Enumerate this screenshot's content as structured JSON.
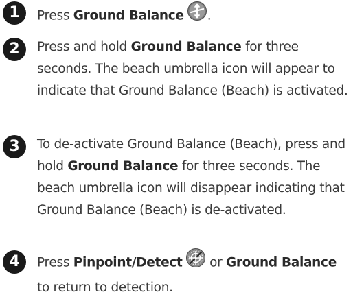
{
  "steps": [
    {
      "number": "1",
      "text_before": "Press ",
      "bold1": "Ground Balance",
      "text_after": ".",
      "icon": "ground-balance-icon"
    },
    {
      "number": "2",
      "text_before": "Press and hold ",
      "bold1": "Ground Balance",
      "text_after": " for three seconds. The beach umbrella icon will appear to indicate that Ground Balance (Beach) is activated."
    },
    {
      "number": "3",
      "text_before": "To de-activate Ground Balance (Beach), press and hold ",
      "bold1": "Ground Balance",
      "text_after": " for three seconds. The beach umbrella icon will disappear indicating that Ground Balance (Beach) is de-activated."
    },
    {
      "number": "4",
      "text_before": "Press ",
      "bold1": "Pinpoint/Detect",
      "text_middle": " or ",
      "bold2": "Ground Balance",
      "text_after": " to return to detection.",
      "icon": "pinpoint-detect-icon"
    }
  ]
}
